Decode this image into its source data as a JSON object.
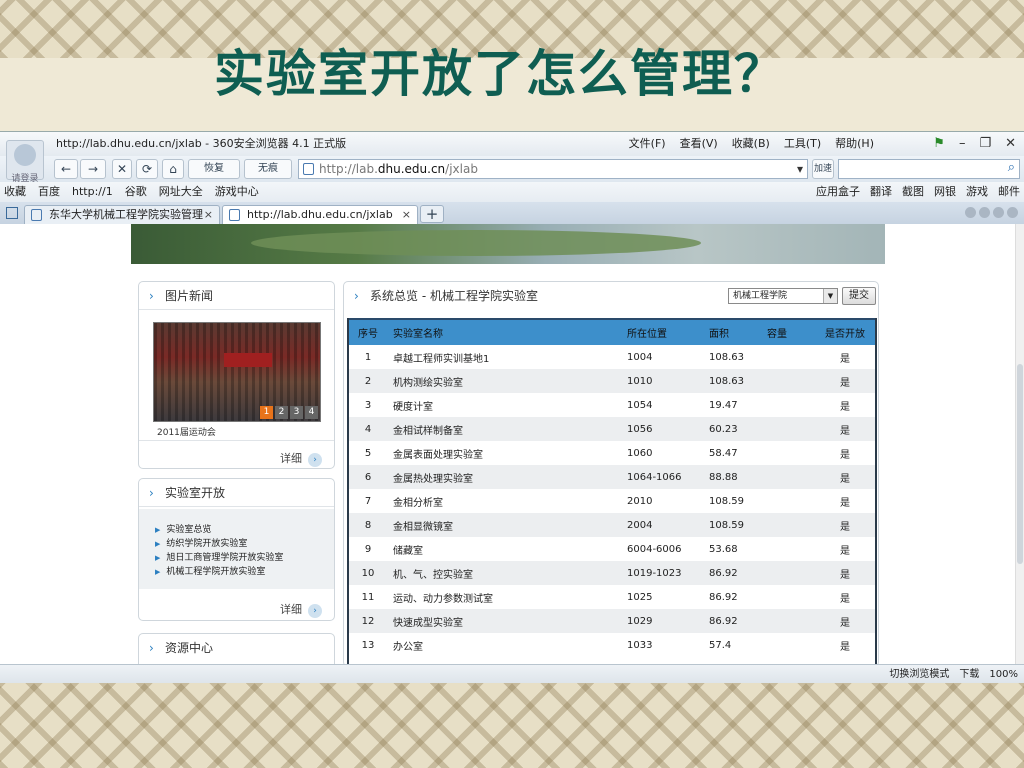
{
  "slide": {
    "title": "实验室开放了怎么管理？"
  },
  "browser": {
    "user_label": "请登录",
    "window_title": "http://lab.dhu.edu.cn/jxlab - 360安全浏览器 4.1 正式版",
    "menu": [
      "文件(F)",
      "查看(V)",
      "收藏(B)",
      "工具(T)",
      "帮助(H)"
    ],
    "back": "←",
    "forward": "→",
    "stop": "✕",
    "refresh": "⟳",
    "home": "⌂",
    "restore": "恢复",
    "no_trace": "无痕",
    "address_prefix": "http://lab.",
    "address_domain": "dhu.edu.cn",
    "address_path": "/jxlab",
    "accelerate": "加速",
    "favorites_left": [
      "收藏",
      "百度",
      "http://1",
      "谷歌",
      "网址大全",
      "游戏中心"
    ],
    "favorites_right": [
      "应用盒子",
      "翻译",
      "截图",
      "网银",
      "游戏",
      "邮件"
    ],
    "tabs": [
      {
        "title": "东华大学机械工程学院实验管理"
      },
      {
        "title": "http://lab.dhu.edu.cn/jxlab"
      }
    ],
    "tab_close": "×",
    "status_right": [
      "切换浏览模式",
      "下载",
      "100%"
    ]
  },
  "sidebar": {
    "news": {
      "title": "图片新闻",
      "caption": "2011届运动会",
      "pager": [
        "1",
        "2",
        "3",
        "4"
      ],
      "more": "详细"
    },
    "open_lab": {
      "title": "实验室开放",
      "links": [
        "实验室总览",
        "纺织学院开放实验室",
        "旭日工商管理学院开放实验室",
        "机械工程学院开放实验室"
      ],
      "more": "详细"
    },
    "resources": {
      "title": "资源中心"
    }
  },
  "main": {
    "title": "系统总览 - 机械工程学院实验室",
    "select_value": "机械工程学院",
    "submit": "提交",
    "columns": [
      "序号",
      "实验室名称",
      "所在位置",
      "面积",
      "容量",
      "是否开放"
    ],
    "rows": [
      [
        "1",
        "卓越工程师实训基地1",
        "1004",
        "108.63",
        "",
        "是"
      ],
      [
        "2",
        "机构测绘实验室",
        "1010",
        "108.63",
        "",
        "是"
      ],
      [
        "3",
        "硬度计室",
        "1054",
        "19.47",
        "",
        "是"
      ],
      [
        "4",
        "金相试样制备室",
        "1056",
        "60.23",
        "",
        "是"
      ],
      [
        "5",
        "金属表面处理实验室",
        "1060",
        "58.47",
        "",
        "是"
      ],
      [
        "6",
        "金属热处理实验室",
        "1064-1066",
        "88.88",
        "",
        "是"
      ],
      [
        "7",
        "金相分析室",
        "2010",
        "108.59",
        "",
        "是"
      ],
      [
        "8",
        "金相显微镜室",
        "2004",
        "108.59",
        "",
        "是"
      ],
      [
        "9",
        "储藏室",
        "6004-6006",
        "53.68",
        "",
        "是"
      ],
      [
        "10",
        "机、气、控实验室",
        "1019-1023",
        "86.92",
        "",
        "是"
      ],
      [
        "11",
        "运动、动力参数测试室",
        "1025",
        "86.92",
        "",
        "是"
      ],
      [
        "12",
        "快速成型实验室",
        "1029",
        "86.92",
        "",
        "是"
      ],
      [
        "13",
        "办公室",
        "1033",
        "57.4",
        "",
        "是"
      ]
    ]
  }
}
